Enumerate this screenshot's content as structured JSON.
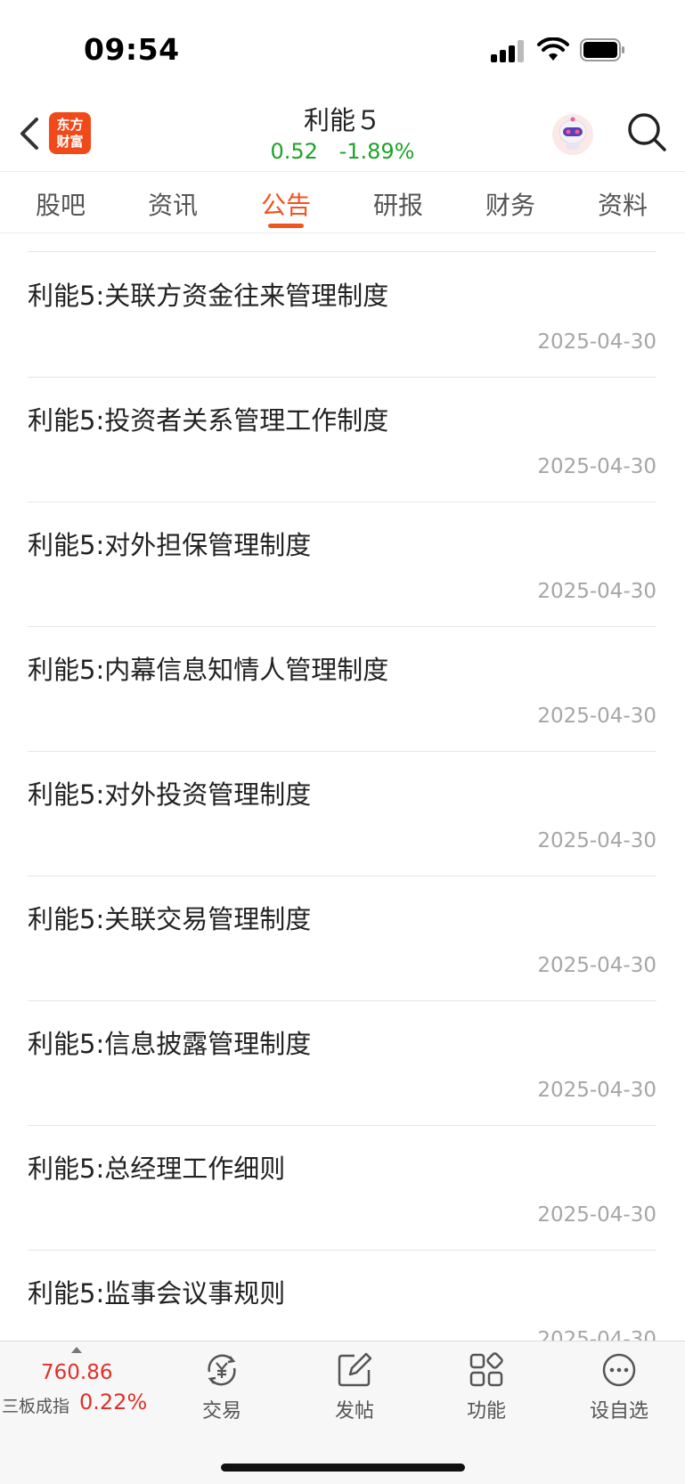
{
  "status_bar": {
    "time": "09:54"
  },
  "header": {
    "logo_line1": "东方",
    "logo_line2": "财富",
    "title": "利能５",
    "price": "0.52",
    "change_pct": "-1.89%",
    "quote_color": "#1ea32a",
    "accent_color": "#f0541f"
  },
  "tabs": [
    {
      "label": "股吧",
      "active": false
    },
    {
      "label": "资讯",
      "active": false
    },
    {
      "label": "公告",
      "active": true
    },
    {
      "label": "研报",
      "active": false
    },
    {
      "label": "财务",
      "active": false
    },
    {
      "label": "资料",
      "active": false
    }
  ],
  "announcements": [
    {
      "title": "利能5:关联方资金往来管理制度",
      "date": "2025-04-30"
    },
    {
      "title": "利能5:投资者关系管理工作制度",
      "date": "2025-04-30"
    },
    {
      "title": "利能5:对外担保管理制度",
      "date": "2025-04-30"
    },
    {
      "title": "利能5:内幕信息知情人管理制度",
      "date": "2025-04-30"
    },
    {
      "title": "利能5:对外投资管理制度",
      "date": "2025-04-30"
    },
    {
      "title": "利能5:关联交易管理制度",
      "date": "2025-04-30"
    },
    {
      "title": "利能5:信息披露管理制度",
      "date": "2025-04-30"
    },
    {
      "title": "利能5:总经理工作细则",
      "date": "2025-04-30"
    },
    {
      "title": "利能5:监事会议事规则",
      "date": "2025-04-30"
    }
  ],
  "bottom_bar": {
    "index_value": "760.86",
    "index_name": "三板成指",
    "index_change": "0.22%",
    "index_color": "#e0302a",
    "nav": [
      {
        "label": "交易",
        "icon": "trade-icon"
      },
      {
        "label": "发帖",
        "icon": "compose-icon"
      },
      {
        "label": "功能",
        "icon": "apps-icon"
      },
      {
        "label": "设自选",
        "icon": "more-icon"
      }
    ]
  }
}
